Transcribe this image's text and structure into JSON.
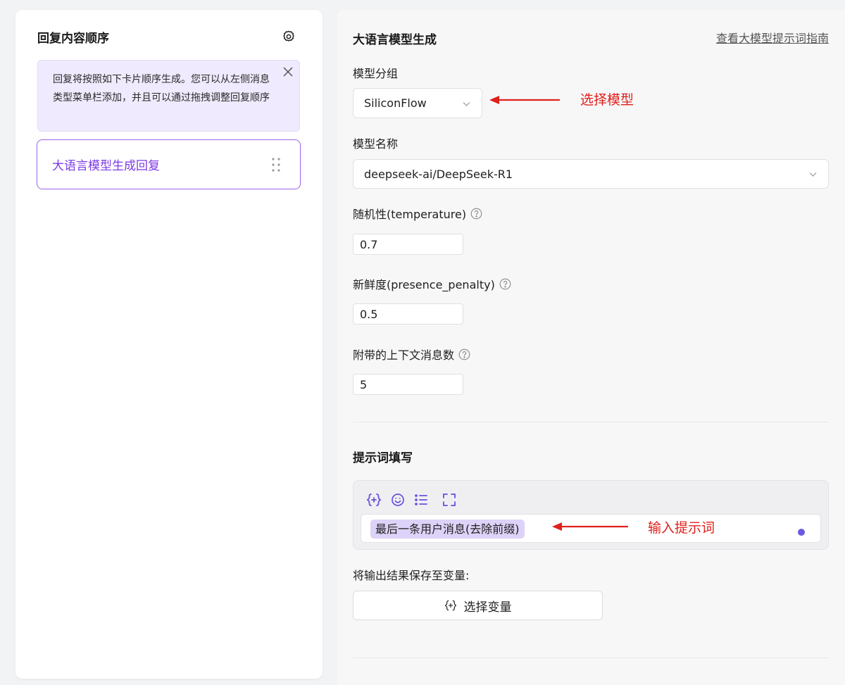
{
  "left": {
    "title": "回复内容顺序",
    "notice": "回复将按照如下卡片顺序生成。您可以从左侧消息类型菜单栏添加，并且可以通过拖拽调整回复顺序",
    "card_label": "大语言模型生成回复"
  },
  "right": {
    "title": "大语言模型生成",
    "guide_link": "查看大模型提示词指南",
    "model_group_label": "模型分组",
    "model_group_value": "SiliconFlow",
    "model_name_label": "模型名称",
    "model_name_value": "deepseek-ai/DeepSeek-R1",
    "temperature_label": "随机性(temperature)",
    "temperature_value": "0.7",
    "presence_label": "新鲜度(presence_penalty)",
    "presence_value": "0.5",
    "context_label": "附带的上下文消息数",
    "context_value": "5",
    "prompt_title": "提示词填写",
    "prompt_chip": "最后一条用户消息(去除前缀)",
    "output_label": "将输出结果保存至变量:",
    "select_var_button": "选择变量"
  },
  "annotations": {
    "select_model": "选择模型",
    "input_prompt": "输入提示词"
  },
  "colors": {
    "accent": "#7c3ae6",
    "annotation": "#e0201b",
    "chip_bg": "#ddd2f7",
    "notice_bg": "#efeafd"
  },
  "icons": {
    "gear": "gear-icon",
    "close": "close-icon",
    "drag": "drag-handle-icon",
    "chevron": "chevron-down-icon",
    "help": "help-circle-icon",
    "variable": "insert-variable-icon",
    "emoji": "emoji-icon",
    "list": "list-icon",
    "fullscreen": "fullscreen-icon"
  }
}
